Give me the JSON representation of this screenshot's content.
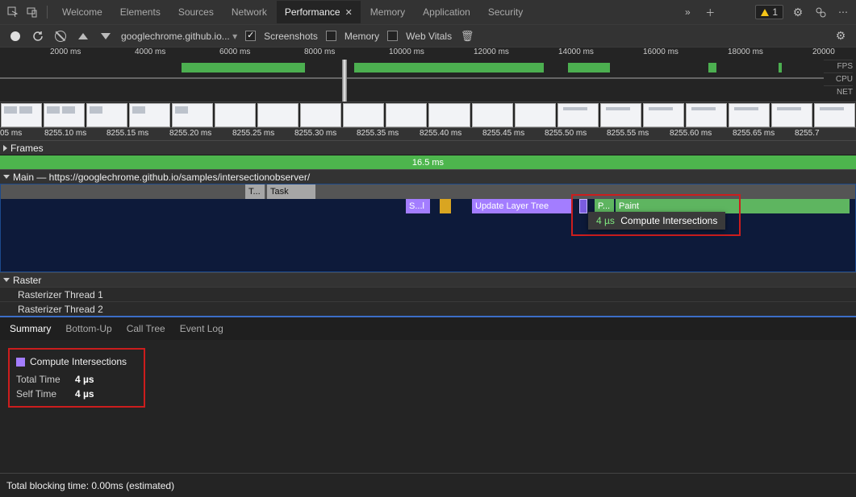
{
  "tabs": {
    "items": [
      "Welcome",
      "Elements",
      "Sources",
      "Network",
      "Performance",
      "Memory",
      "Application",
      "Security"
    ],
    "active_index": 4,
    "more_icon": "»",
    "add_icon": "＋"
  },
  "top_right": {
    "warn_count": "1"
  },
  "toolbar": {
    "site": "googlechrome.github.io...",
    "screenshots_label": "Screenshots",
    "screenshots_checked": true,
    "memory_label": "Memory",
    "memory_checked": false,
    "webvitals_label": "Web Vitals",
    "webvitals_checked": false
  },
  "overview": {
    "ticks": [
      "2000 ms",
      "4000 ms",
      "6000 ms",
      "8000 ms",
      "10000 ms",
      "12000 ms",
      "14000 ms",
      "16000 ms",
      "18000 ms",
      "20000"
    ],
    "y_labels": [
      "FPS",
      "CPU",
      "NET"
    ],
    "handle_pct": 41.5
  },
  "ruler": {
    "ticks": [
      "05 ms",
      "8255.10 ms",
      "8255.15 ms",
      "8255.20 ms",
      "8255.25 ms",
      "8255.30 ms",
      "8255.35 ms",
      "8255.40 ms",
      "8255.45 ms",
      "8255.50 ms",
      "8255.55 ms",
      "8255.60 ms",
      "8255.65 ms",
      "8255.7"
    ]
  },
  "frames": {
    "label": "Frames",
    "duration": "16.5 ms"
  },
  "main": {
    "label": "Main — https://googlechrome.github.io/samples/intersectionobserver/"
  },
  "flame": {
    "task_short": "T...",
    "task": "Task",
    "si": "S...l",
    "ult": "Update Layer Tree",
    "p": "P...",
    "paint": "Paint"
  },
  "tooltip": {
    "time": "4 µs",
    "name": "Compute Intersections"
  },
  "raster": {
    "label": "Raster",
    "threads": [
      "Rasterizer Thread 1",
      "Rasterizer Thread 2"
    ]
  },
  "dtabs": {
    "items": [
      "Summary",
      "Bottom-Up",
      "Call Tree",
      "Event Log"
    ],
    "active": 0
  },
  "summary": {
    "title": "Compute Intersections",
    "rows": [
      {
        "label": "Total Time",
        "value": "4 µs"
      },
      {
        "label": "Self Time",
        "value": "4 µs"
      }
    ]
  },
  "blocking": {
    "text": "Total blocking time: 0.00ms (estimated)"
  },
  "chart_data": null
}
